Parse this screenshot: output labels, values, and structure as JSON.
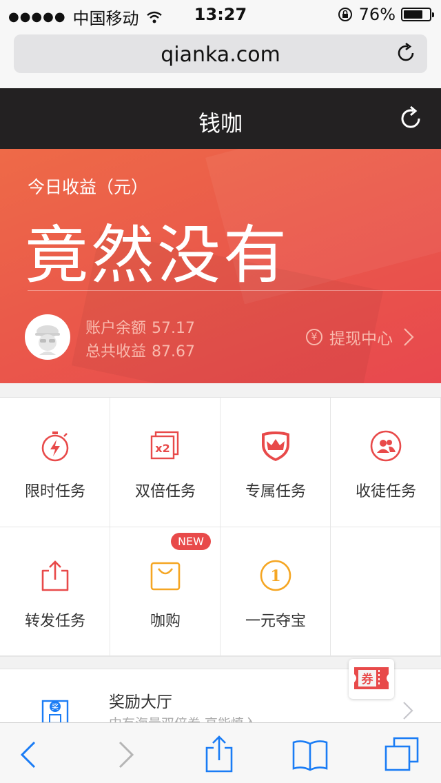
{
  "status_bar": {
    "signal": "●●●●●",
    "carrier": "中国移动",
    "time": "13:27",
    "battery": "76%"
  },
  "browser": {
    "url": "qianka.com"
  },
  "header": {
    "title": "钱咖"
  },
  "earnings": {
    "label": "今日收益（元）",
    "value": "竟然没有",
    "balance_label": "账户余额",
    "balance_value": "57.17",
    "total_label": "总共收益",
    "total_value": "87.67",
    "withdraw_label": "提现中心",
    "yen_symbol": "¥"
  },
  "tasks": [
    {
      "label": "限时任务",
      "icon": "stopwatch-icon"
    },
    {
      "label": "双倍任务",
      "icon": "double-icon"
    },
    {
      "label": "专属任务",
      "icon": "crown-shield-icon"
    },
    {
      "label": "收徒任务",
      "icon": "apprentice-icon"
    },
    {
      "label": "转发任务",
      "icon": "share-icon"
    },
    {
      "label": "咖购",
      "icon": "shopping-bag-icon",
      "badge": "NEW"
    },
    {
      "label": "一元夺宝",
      "icon": "coin-icon"
    }
  ],
  "double_icon_text": "x2",
  "coin_icon_text": "1",
  "reward_hall": {
    "title": "奖励大厅",
    "subtitle": "中有海量双倍券 高能慎入",
    "icon_text": "奖",
    "coupon_text": "券"
  },
  "colors": {
    "accent": "#e84a4a",
    "orange": "#f5a623",
    "hero_top": "#ee6a48",
    "hero_bottom": "#e8484e",
    "ios_blue": "#1a7cf5"
  }
}
